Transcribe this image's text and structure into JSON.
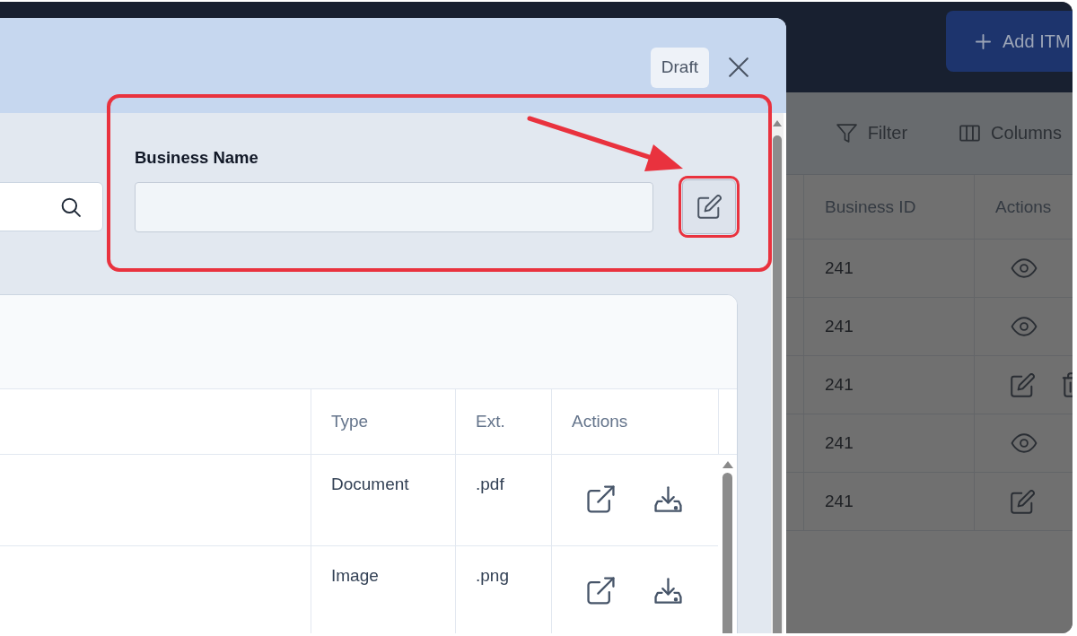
{
  "page": {
    "add_button": {
      "label": "Add ITM"
    },
    "toolbar": [
      {
        "kind": "filter",
        "label": "Filter"
      },
      {
        "kind": "columns",
        "label": "Columns"
      }
    ],
    "table": {
      "columns": [
        "Business ID",
        "Actions"
      ],
      "rows": [
        {
          "business_id": "241",
          "actions": [
            {
              "kind": "view"
            }
          ]
        },
        {
          "business_id": "241",
          "actions": [
            {
              "kind": "view"
            }
          ]
        },
        {
          "business_id": "241",
          "actions": [
            {
              "kind": "edit"
            },
            {
              "kind": "delete"
            }
          ]
        },
        {
          "business_id": "241",
          "actions": [
            {
              "kind": "view"
            }
          ]
        },
        {
          "business_id": "241",
          "actions": [
            {
              "kind": "edit"
            }
          ]
        }
      ]
    }
  },
  "modal": {
    "status_badge": "Draft",
    "business_name": {
      "label": "Business Name",
      "highlighted": true
    },
    "edit_button": {
      "highlighted": true
    },
    "files_table": {
      "columns": [
        "Type",
        "Ext.",
        "Actions"
      ],
      "rows": [
        {
          "type": "Document",
          "ext": ".pdf",
          "actions": [
            {
              "kind": "open"
            },
            {
              "kind": "download"
            }
          ]
        },
        {
          "type": "Image",
          "ext": ".png",
          "actions": [
            {
              "kind": "open"
            },
            {
              "kind": "download"
            }
          ]
        }
      ]
    }
  }
}
